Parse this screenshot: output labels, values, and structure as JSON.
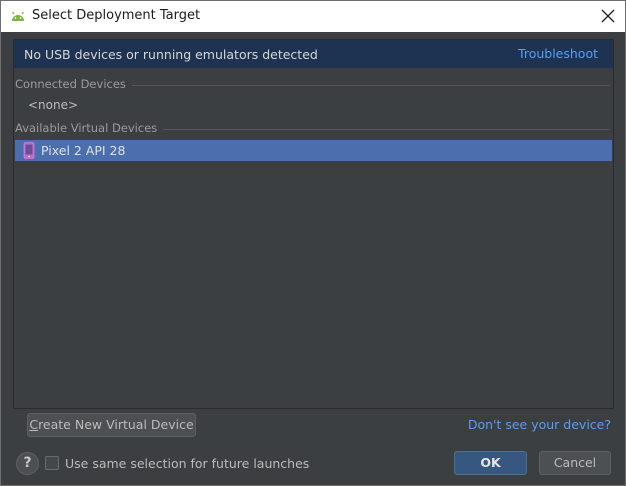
{
  "window": {
    "title": "Select Deployment Target",
    "app_icon": "android-icon",
    "close_icon": "close-icon"
  },
  "banner": {
    "message": "No USB devices or running emulators detected",
    "link": "Troubleshoot",
    "color": "#1e3351"
  },
  "sections": {
    "connected": {
      "label": "Connected Devices",
      "empty_text": "<none>"
    },
    "available": {
      "label": "Available Virtual Devices",
      "devices": [
        {
          "name": "Pixel 2 API 28",
          "icon": "phone-icon",
          "selected": true
        }
      ]
    }
  },
  "buttons": {
    "create": "Create New Virtual Device",
    "create_mnemonic": "C",
    "create_rest": "reate New Virtual Device",
    "ok": "OK",
    "cancel": "Cancel"
  },
  "links": {
    "dont_see": "Don't see your device?"
  },
  "footer": {
    "help": "?",
    "checkbox_label": "Use same selection for future launches",
    "checkbox_checked": false
  },
  "colors": {
    "background": "#3c3f41",
    "selection": "#4b6eaf",
    "link": "#589df6",
    "primary_button": "#365880"
  }
}
